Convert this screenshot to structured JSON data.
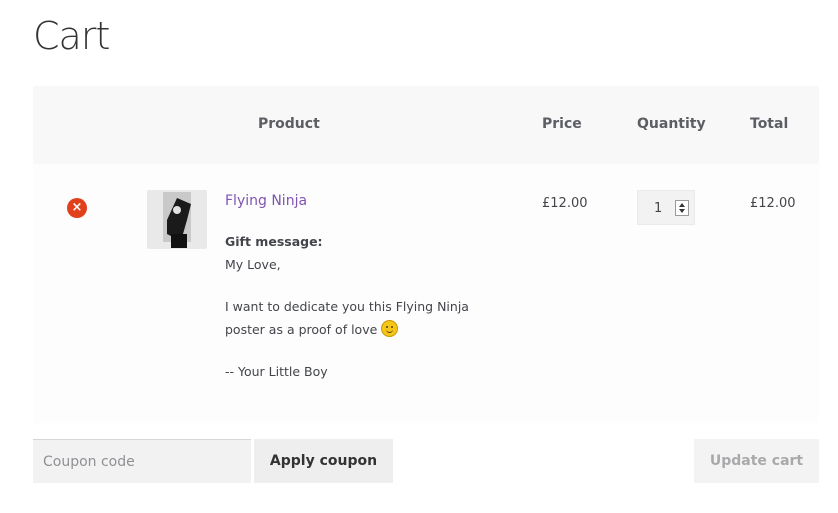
{
  "page": {
    "title": "Cart"
  },
  "table": {
    "headers": {
      "product": "Product",
      "price": "Price",
      "quantity": "Quantity",
      "total": "Total"
    }
  },
  "item": {
    "remove_icon": "remove-x-icon",
    "product_name": "Flying Ninja",
    "gift_label": "Gift message:",
    "gift_lines": [
      "My Love,",
      "I want to dedicate you this Flying Ninja",
      "poster as a proof of love",
      "-- Your Little Boy"
    ],
    "emoji": "smiley-emoji-icon",
    "price": "£12.00",
    "quantity": "1",
    "total": "£12.00"
  },
  "actions": {
    "coupon_placeholder": "Coupon code",
    "apply_coupon_label": "Apply coupon",
    "update_cart_label": "Update cart"
  },
  "colors": {
    "accent_link": "#7f54b3",
    "remove_red": "#e2401c",
    "header_bg": "#f8f8f8"
  }
}
